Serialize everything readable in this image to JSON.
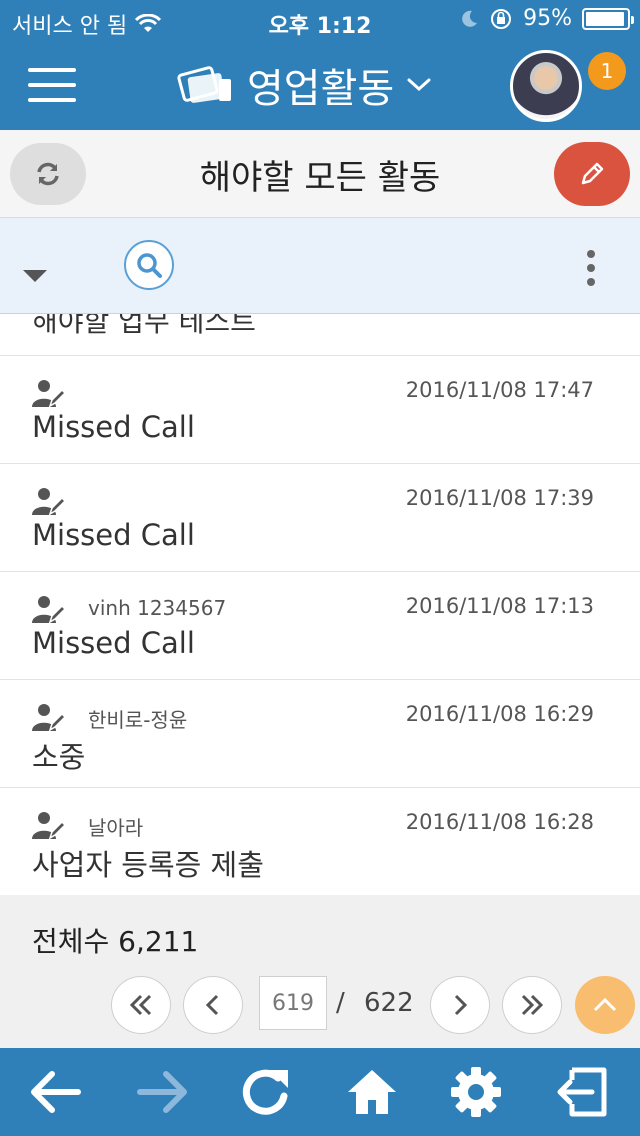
{
  "status_bar": {
    "carrier": "서비스 안 됨",
    "time": "오후 1:12",
    "battery": "95%",
    "battery_level": 0.95
  },
  "header": {
    "title": "영업활동",
    "notification_count": "1"
  },
  "title_bar": {
    "title": "해야할 모든 활동"
  },
  "list": {
    "partial_item": {
      "subject": "해야할 업무 테스트"
    },
    "items": [
      {
        "contact": "",
        "date": "2016/11/08 17:47",
        "subject": "Missed Call"
      },
      {
        "contact": "",
        "date": "2016/11/08 17:39",
        "subject": "Missed Call"
      },
      {
        "contact": "vinh 1234567",
        "date": "2016/11/08 17:13",
        "subject": "Missed Call"
      },
      {
        "contact": "한비로-정윤",
        "date": "2016/11/08 16:29",
        "subject": "소중"
      },
      {
        "contact": "날아라",
        "date": "2016/11/08 16:28",
        "subject": "사업자 등록증 제출"
      }
    ]
  },
  "footer": {
    "total_label": "전체수 6,211",
    "current_page": "619",
    "separator": "/",
    "total_pages": "622"
  },
  "colors": {
    "primary": "#2f80b8",
    "accent_red": "#d9533f",
    "badge_orange": "#f39a1c",
    "scroll_top": "#f8bd6e",
    "filter_bg": "#e9f1fb"
  },
  "icons": [
    "wifi-icon",
    "moon-icon",
    "rotation-lock-icon",
    "battery-icon",
    "menu-icon",
    "briefcase-icon",
    "chevron-down-icon",
    "avatar",
    "refresh-icon",
    "pencil-icon",
    "caret-down-icon",
    "search-icon",
    "more-vertical-icon",
    "person-edit-icon",
    "first-page-icon",
    "prev-page-icon",
    "next-page-icon",
    "last-page-icon",
    "chevron-up-icon",
    "back-arrow-icon",
    "forward-arrow-icon",
    "reload-icon",
    "home-icon",
    "gear-icon",
    "logout-icon"
  ]
}
